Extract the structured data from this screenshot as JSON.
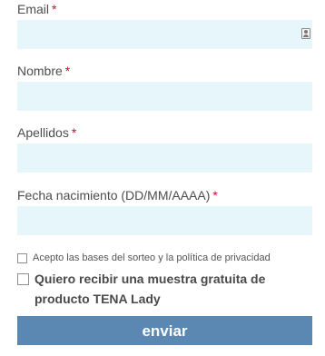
{
  "form": {
    "email": {
      "label": "Email",
      "required_mark": "*",
      "value": ""
    },
    "nombre": {
      "label": "Nombre",
      "required_mark": "*",
      "value": ""
    },
    "apellidos": {
      "label": "Apellidos",
      "required_mark": "*",
      "value": ""
    },
    "fecha": {
      "label": "Fecha nacimiento (DD/MM/AAAA)",
      "required_mark": "*",
      "value": ""
    },
    "accept_terms": {
      "label": "Acepto las bases del sorteo y la política de privacidad",
      "checked": false
    },
    "sample_request": {
      "label": "Quiero recibir una muestra gratuita de producto TENA Lady",
      "checked": false
    },
    "submit_label": "enviar"
  },
  "colors": {
    "input_bg": "#e6f6fb",
    "button_bg": "#5b87b3",
    "required": "#c8102e"
  },
  "icons": {
    "email_autofill": "contact-card-icon"
  }
}
